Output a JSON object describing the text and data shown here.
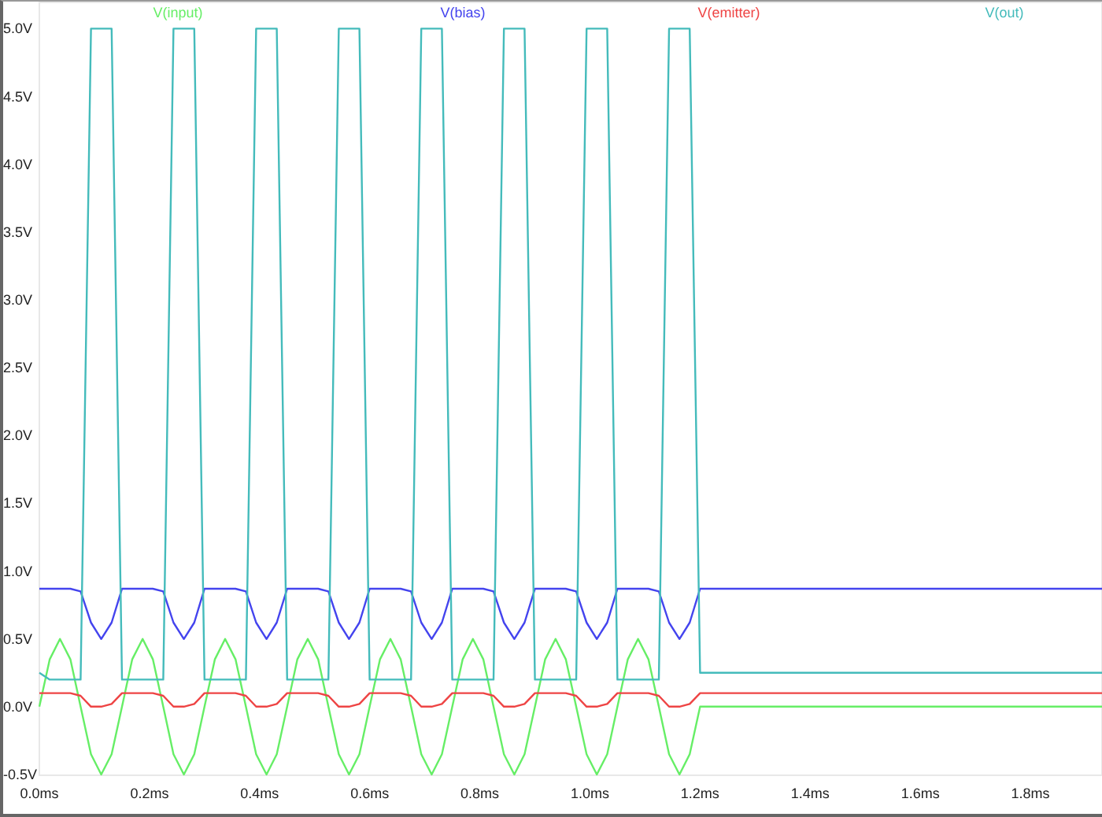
{
  "chart_data": {
    "type": "line",
    "xlim": [
      0,
      1.93
    ],
    "ylim": [
      -0.5,
      5.2
    ],
    "x": [
      0,
      0.01875,
      0.0375,
      0.05625,
      0.075,
      0.09375,
      0.1125,
      0.13125,
      0.15,
      0.16875,
      0.1875,
      0.20625,
      0.225,
      0.24375,
      0.2625,
      0.28125,
      0.3,
      0.31875,
      0.3375,
      0.35625,
      0.375,
      0.39375,
      0.4125,
      0.43125,
      0.45,
      0.46875,
      0.4875,
      0.50625,
      0.525,
      0.54375,
      0.5625,
      0.58125,
      0.6,
      0.61875,
      0.6375,
      0.65625,
      0.675,
      0.69375,
      0.7125,
      0.73125,
      0.75,
      0.76875,
      0.7875,
      0.80625,
      0.825,
      0.84375,
      0.8625,
      0.88125,
      0.9,
      0.91875,
      0.9375,
      0.95625,
      0.975,
      0.99375,
      1.0125,
      1.03125,
      1.05,
      1.06875,
      1.0875,
      1.10625,
      1.125,
      1.14375,
      1.1625,
      1.18125,
      1.2,
      1.93
    ],
    "series": [
      {
        "name": "V(input)",
        "color": "#66ee66",
        "values": [
          0,
          0.35,
          0.5,
          0.35,
          0,
          -0.35,
          -0.5,
          -0.35,
          0,
          0.35,
          0.5,
          0.35,
          0,
          -0.35,
          -0.5,
          -0.35,
          0,
          0.35,
          0.5,
          0.35,
          0,
          -0.35,
          -0.5,
          -0.35,
          0,
          0.35,
          0.5,
          0.35,
          0,
          -0.35,
          -0.5,
          -0.35,
          0,
          0.35,
          0.5,
          0.35,
          0,
          -0.35,
          -0.5,
          -0.35,
          0,
          0.35,
          0.5,
          0.35,
          0,
          -0.35,
          -0.5,
          -0.35,
          0,
          0.35,
          0.5,
          0.35,
          0,
          -0.35,
          -0.5,
          -0.35,
          0,
          0.35,
          0.5,
          0.35,
          0,
          -0.35,
          -0.5,
          -0.35,
          0,
          0
        ]
      },
      {
        "name": "V(bias)",
        "color": "#4444ee",
        "values": [
          0.87,
          0.87,
          0.87,
          0.87,
          0.85,
          0.62,
          0.5,
          0.62,
          0.87,
          0.87,
          0.87,
          0.87,
          0.85,
          0.62,
          0.5,
          0.62,
          0.87,
          0.87,
          0.87,
          0.87,
          0.85,
          0.62,
          0.5,
          0.62,
          0.87,
          0.87,
          0.87,
          0.87,
          0.85,
          0.62,
          0.5,
          0.62,
          0.87,
          0.87,
          0.87,
          0.87,
          0.85,
          0.62,
          0.5,
          0.62,
          0.87,
          0.87,
          0.87,
          0.87,
          0.85,
          0.62,
          0.5,
          0.62,
          0.87,
          0.87,
          0.87,
          0.87,
          0.85,
          0.62,
          0.5,
          0.62,
          0.87,
          0.87,
          0.87,
          0.87,
          0.85,
          0.62,
          0.5,
          0.62,
          0.87,
          0.87
        ]
      },
      {
        "name": "V(emitter)",
        "color": "#ee4444",
        "values": [
          0.1,
          0.1,
          0.1,
          0.1,
          0.08,
          0,
          0,
          0.02,
          0.1,
          0.1,
          0.1,
          0.1,
          0.08,
          0,
          0,
          0.02,
          0.1,
          0.1,
          0.1,
          0.1,
          0.08,
          0,
          0,
          0.02,
          0.1,
          0.1,
          0.1,
          0.1,
          0.08,
          0,
          0,
          0.02,
          0.1,
          0.1,
          0.1,
          0.1,
          0.08,
          0,
          0,
          0.02,
          0.1,
          0.1,
          0.1,
          0.1,
          0.08,
          0,
          0,
          0.02,
          0.1,
          0.1,
          0.1,
          0.1,
          0.08,
          0,
          0,
          0.02,
          0.1,
          0.1,
          0.1,
          0.1,
          0.08,
          0,
          0,
          0.02,
          0.1,
          0.1
        ]
      },
      {
        "name": "V(out)",
        "color": "#44bbbb",
        "values": [
          0.25,
          0.2,
          0.2,
          0.2,
          0.2,
          5,
          5,
          5,
          0.2,
          0.2,
          0.2,
          0.2,
          0.2,
          5,
          5,
          5,
          0.2,
          0.2,
          0.2,
          0.2,
          0.2,
          5,
          5,
          5,
          0.2,
          0.2,
          0.2,
          0.2,
          0.2,
          5,
          5,
          5,
          0.2,
          0.2,
          0.2,
          0.2,
          0.2,
          5,
          5,
          5,
          0.2,
          0.2,
          0.2,
          0.2,
          0.2,
          5,
          5,
          5,
          0.2,
          0.2,
          0.2,
          0.2,
          0.2,
          5,
          5,
          5,
          0.2,
          0.2,
          0.2,
          0.2,
          0.2,
          5,
          5,
          5,
          0.25,
          0.25
        ]
      }
    ],
    "yticks": [
      {
        "value": 5,
        "label": "5.0V"
      },
      {
        "value": 4.5,
        "label": "4.5V"
      },
      {
        "value": 4,
        "label": "4.0V"
      },
      {
        "value": 3.5,
        "label": "3.5V"
      },
      {
        "value": 3,
        "label": "3.0V"
      },
      {
        "value": 2.5,
        "label": "2.5V"
      },
      {
        "value": 2,
        "label": "2.0V"
      },
      {
        "value": 1.5,
        "label": "1.5V"
      },
      {
        "value": 1,
        "label": "1.0V"
      },
      {
        "value": 0.5,
        "label": "0.5V"
      },
      {
        "value": 0,
        "label": "0.0V"
      },
      {
        "value": -0.5,
        "label": "-0.5V"
      }
    ],
    "xticks": [
      {
        "value": 0,
        "label": "0.0ms"
      },
      {
        "value": 0.2,
        "label": "0.2ms"
      },
      {
        "value": 0.4,
        "label": "0.4ms"
      },
      {
        "value": 0.6,
        "label": "0.6ms"
      },
      {
        "value": 0.8,
        "label": "0.8ms"
      },
      {
        "value": 1,
        "label": "1.0ms"
      },
      {
        "value": 1.2,
        "label": "1.2ms"
      },
      {
        "value": 1.4,
        "label": "1.4ms"
      },
      {
        "value": 1.6,
        "label": "1.6ms"
      },
      {
        "value": 1.8,
        "label": "1.8ms"
      }
    ]
  }
}
